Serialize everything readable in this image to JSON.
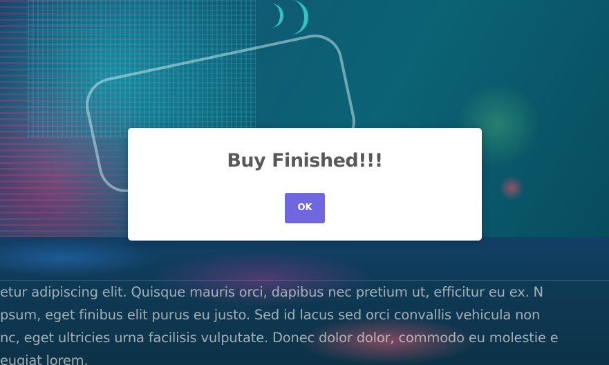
{
  "dialog": {
    "title": "Buy Finished!!!",
    "ok_label": "OK",
    "button_color": "#7066e0"
  },
  "background_text": {
    "lines": [
      "etur adipiscing elit. Quisque mauris orci, dapibus nec pretium ut, efficitur eu ex. N",
      "psum, eget finibus elit purus eu justo. Sed id lacus sed orci convallis vehicula non",
      "nc, eget ultricies urna facilisis vulputate. Donec dolor dolor, commodo eu molestie e",
      "eugiat lorem."
    ]
  }
}
